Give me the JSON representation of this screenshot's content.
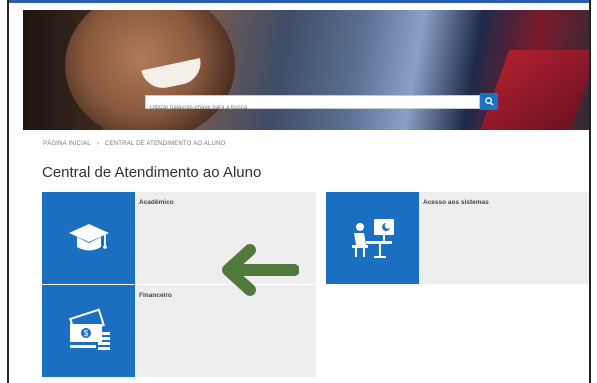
{
  "search": {
    "placeholder": "Utilizar palavras-chave para a busca"
  },
  "breadcrumb": {
    "home": "PÁGINA INICIAL",
    "separator": "›",
    "current": "CENTRAL DE ATENDIMENTO AO ALUNO"
  },
  "page": {
    "title": "Central de Atendimento ao Aluno"
  },
  "cards": [
    {
      "label": "Acadêmico",
      "icon": "graduation-cap-icon"
    },
    {
      "label": "Financeiro",
      "icon": "money-icon"
    },
    {
      "label": "Acesso aos sistemas",
      "icon": "computer-user-icon"
    }
  ],
  "colors": {
    "accent": "#1a6fc1",
    "card_bg": "#eeeeee",
    "arrow": "#4f7a3c"
  }
}
